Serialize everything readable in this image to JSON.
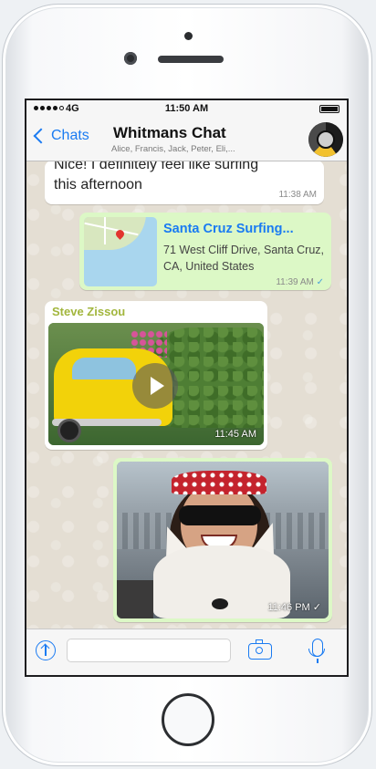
{
  "status_bar": {
    "carrier": "4G",
    "time": "11:50 AM"
  },
  "header": {
    "back_label": "Chats",
    "title": "Whitmans Chat",
    "subtitle": "Alice, Francis, Jack, Peter, Eli,..."
  },
  "messages": {
    "text_message": {
      "text": "Nice! I definitely feel like surfing this afternoon",
      "time": "11:38 AM"
    },
    "location_message": {
      "name": "Santa Cruz Surfing...",
      "address": "71 West Cliff Drive, Santa Cruz, CA, United States",
      "time": "11:39 AM",
      "status_icon": "double-check-icon"
    },
    "video_message": {
      "sender": "Steve Zissou",
      "time": "11:45 AM",
      "icon": "play-icon"
    },
    "photo_message": {
      "time": "11:46 PM",
      "status_icon": "check-icon"
    }
  },
  "input_bar": {
    "upload_icon": "upload-icon",
    "camera_icon": "camera-icon",
    "mic_icon": "microphone-icon",
    "placeholder": ""
  },
  "colors": {
    "accent": "#1a7bf2",
    "outgoing_bubble": "#dcf8c6",
    "incoming_bubble": "#ffffff",
    "sender_name": "#a2b63d"
  }
}
